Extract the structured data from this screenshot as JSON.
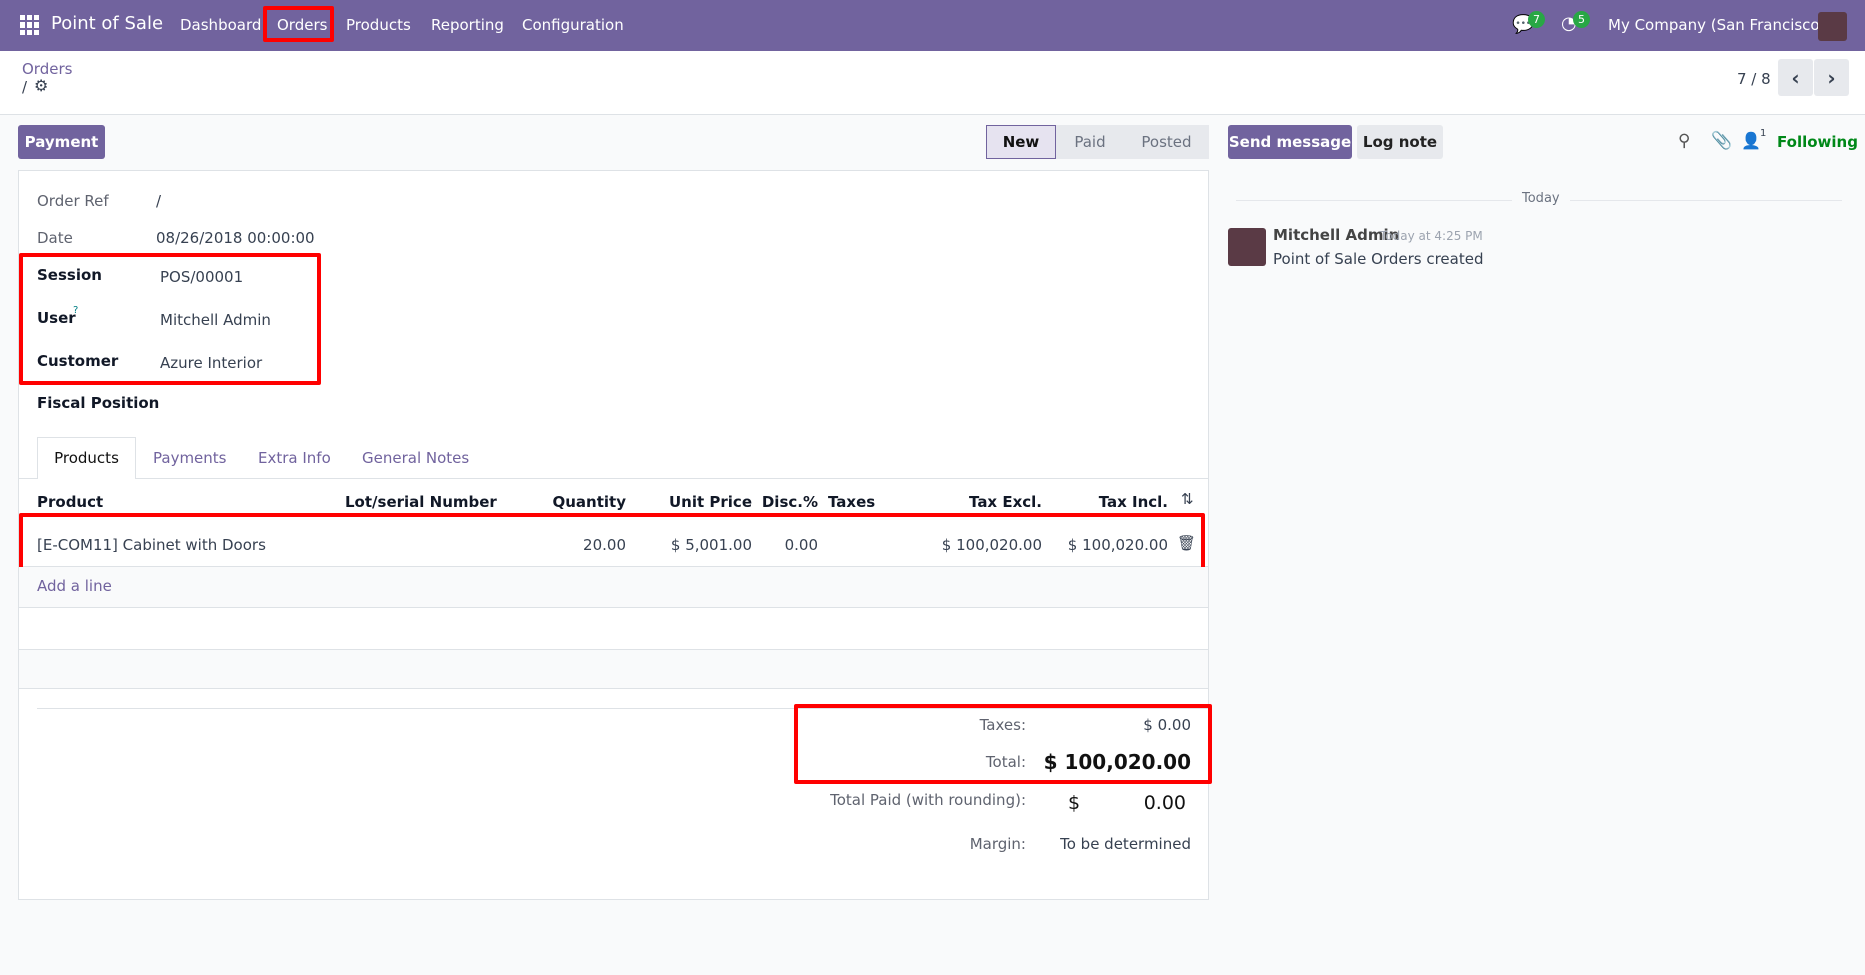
{
  "nav": {
    "app": "Point of Sale",
    "menu": [
      "Dashboard",
      "Orders",
      "Products",
      "Reporting",
      "Configuration"
    ],
    "messages_count": "7",
    "activities_count": "5",
    "company": "My Company (San Francisco)"
  },
  "breadcrumb": {
    "parent": "Orders",
    "current": "/"
  },
  "pager": {
    "value": "7 / 8"
  },
  "actions": {
    "payment": "Payment"
  },
  "statusbar": [
    "New",
    "Paid",
    "Posted"
  ],
  "form": {
    "order_ref_label": "Order Ref",
    "order_ref": "/",
    "date_label": "Date",
    "date": "08/26/2018 00:00:00",
    "session_label": "Session",
    "session": "POS/00001",
    "user_label": "User",
    "user_help": "?",
    "user": "Mitchell Admin",
    "customer_label": "Customer",
    "customer": "Azure Interior",
    "fiscal_label": "Fiscal Position"
  },
  "tabs": [
    "Products",
    "Payments",
    "Extra Info",
    "General Notes"
  ],
  "table": {
    "headers": [
      "Product",
      "Lot/serial Number",
      "Quantity",
      "Unit Price",
      "Disc.%",
      "Taxes",
      "Tax Excl.",
      "Tax Incl."
    ],
    "rows": [
      {
        "product": "[E-COM11] Cabinet with Doors",
        "lot": "",
        "qty": "20.00",
        "price": "$ 5,001.00",
        "disc": "0.00",
        "taxes": "",
        "excl": "$ 100,020.00",
        "incl": "$ 100,020.00"
      }
    ],
    "add_line": "Add a line"
  },
  "totals": {
    "taxes_label": "Taxes:",
    "taxes": "$ 0.00",
    "total_label": "Total:",
    "total": "$ 100,020.00",
    "paid_label": "Total Paid (with rounding):",
    "paid_currency": "$",
    "paid": "0.00",
    "margin_label": "Margin:",
    "margin": "To be determined"
  },
  "chatter": {
    "send": "Send message",
    "log": "Log note",
    "followers": "1",
    "following": "Following",
    "date_sep": "Today",
    "author": "Mitchell Admin",
    "time": "Today at 4:25 PM",
    "body": "Point of Sale Orders created"
  }
}
